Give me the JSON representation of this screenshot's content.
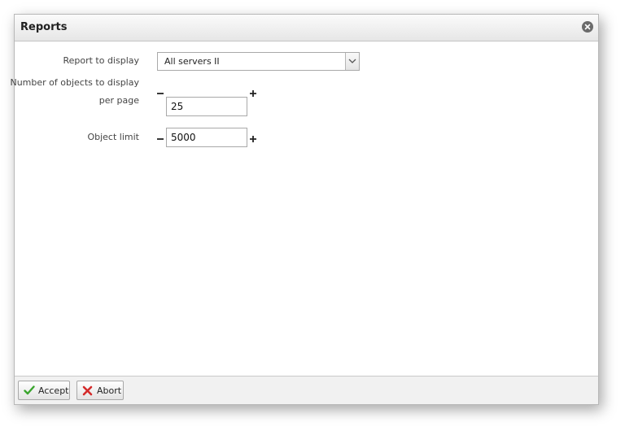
{
  "dialog": {
    "title": "Reports"
  },
  "form": {
    "report_label": "Report to display",
    "report_value": "All servers II",
    "objects_per_page_label_line1": "Number of objects to display",
    "objects_per_page_label_line2": "per page",
    "objects_per_page_value": "25",
    "object_limit_label": "Object limit",
    "object_limit_value": "5000"
  },
  "footer": {
    "accept_label": "Accept",
    "abort_label": "Abort"
  },
  "colors": {
    "accept_icon": "#3aa52e",
    "abort_icon": "#d42a2a",
    "close_icon": "#6b6b6b"
  },
  "icons": {
    "close": "close-icon",
    "dropdown": "chevron-down-icon",
    "decrement": "minus-icon",
    "increment": "plus-icon",
    "accept": "checkmark-icon",
    "abort": "x-icon"
  }
}
